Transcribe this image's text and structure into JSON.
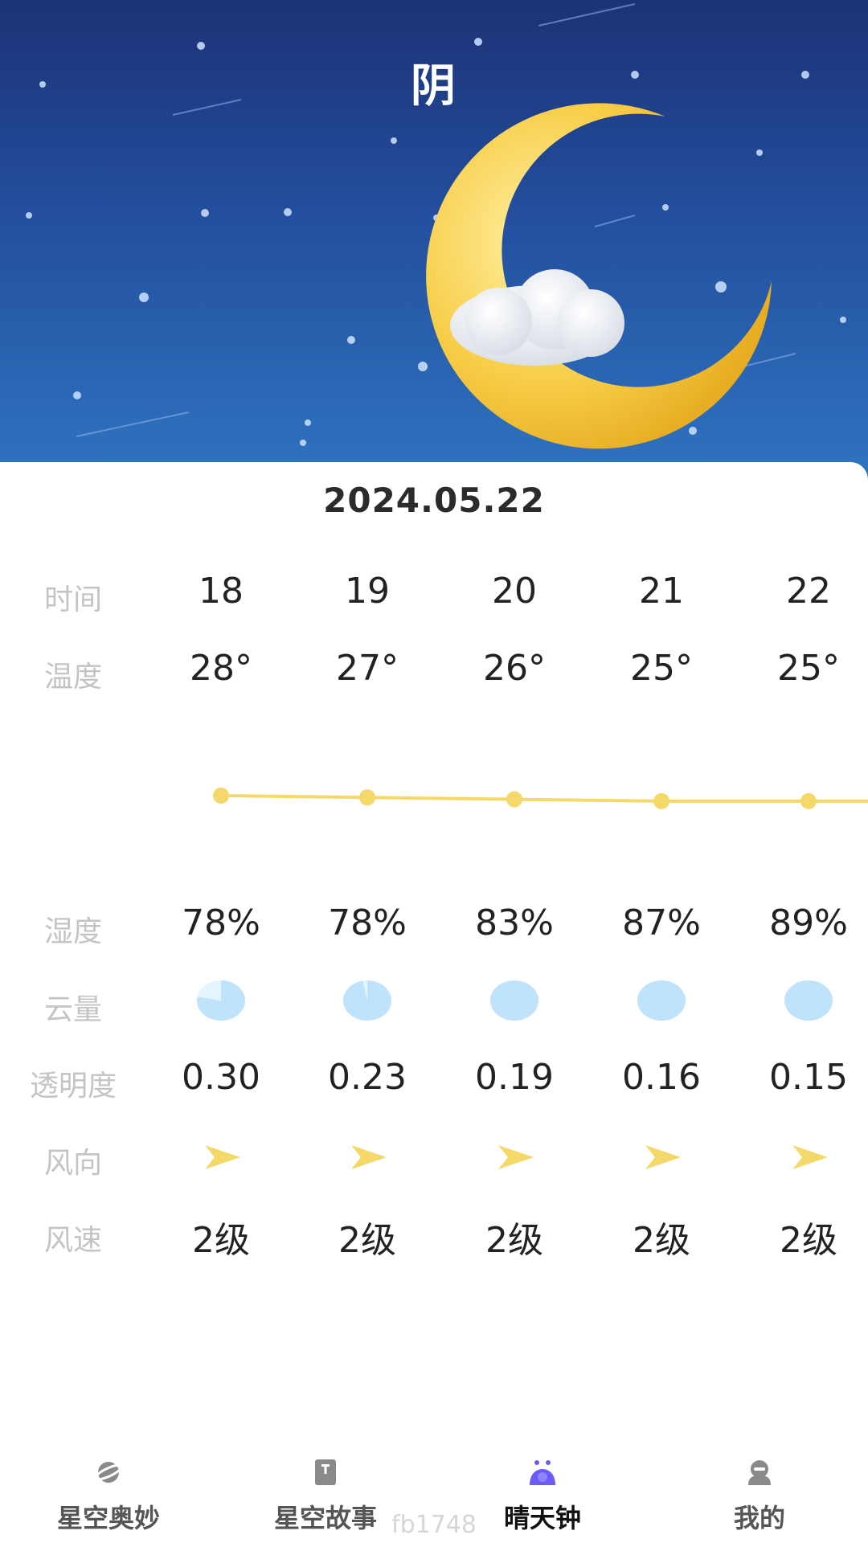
{
  "header": {
    "weather": "阴",
    "date": "2024.05.22"
  },
  "labels": {
    "time": "时间",
    "temperature": "温度",
    "humidity": "湿度",
    "cloud": "云量",
    "transparency": "透明度",
    "wind_direction": "风向",
    "wind_speed": "风速"
  },
  "hours": [
    "18",
    "19",
    "20",
    "21",
    "22"
  ],
  "temperatures": [
    "28°",
    "27°",
    "26°",
    "25°",
    "25°"
  ],
  "temperature_values": [
    28,
    27,
    26,
    25,
    25
  ],
  "humidity": [
    "78%",
    "78%",
    "83%",
    "87%",
    "89%"
  ],
  "cloud_cover": [
    0.78,
    0.97,
    1.0,
    1.0,
    1.0
  ],
  "transparency": [
    "0.30",
    "0.23",
    "0.19",
    "0.16",
    "0.15"
  ],
  "wind_direction_icon": "arrow-right-icon",
  "wind_speed": [
    "2级",
    "2级",
    "2级",
    "2级",
    "2级"
  ],
  "colors": {
    "sky_top": "#1c3276",
    "sky_bottom": "#2f74c0",
    "accent_yellow": "#f4d96a",
    "cloud_blue": "#bfe3fb",
    "nav_active": "#6b5cf6"
  },
  "nav": {
    "items": [
      {
        "label": "星空奥妙",
        "icon": "planet-icon"
      },
      {
        "label": "星空故事",
        "icon": "book-icon"
      },
      {
        "label": "晴天钟",
        "icon": "weather-clock-icon"
      },
      {
        "label": "我的",
        "icon": "profile-icon"
      }
    ],
    "active_index": 2
  },
  "watermark": "fb1748"
}
